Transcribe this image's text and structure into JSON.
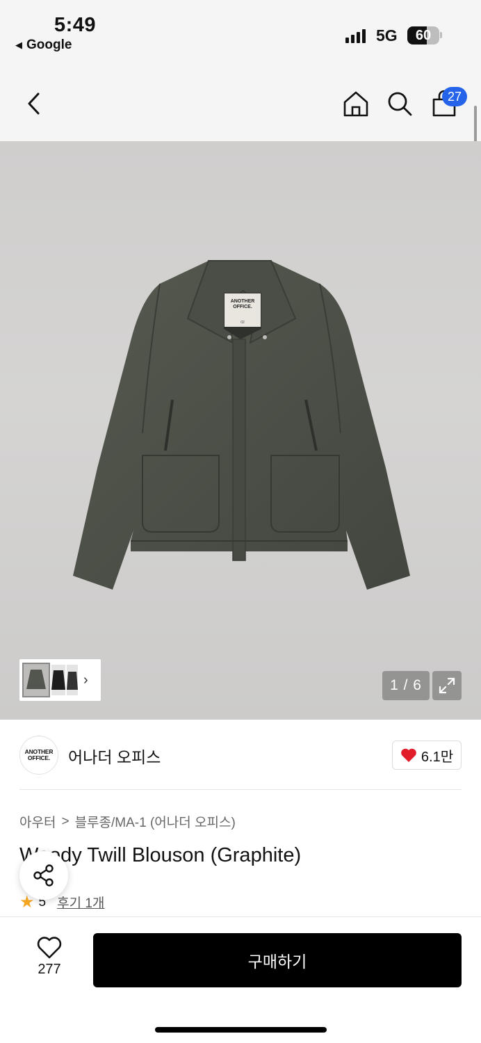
{
  "status_bar": {
    "time": "5:49",
    "back_app": "Google",
    "network": "5G",
    "battery": "60"
  },
  "nav": {
    "cart_count": "27",
    "icons": [
      "back-arrow-icon",
      "home-icon",
      "search-icon",
      "cart-icon"
    ]
  },
  "gallery": {
    "label_brand": "ANOTHER\nOFFICE.",
    "label_size": "02",
    "page_counter": "1 / 6"
  },
  "brand": {
    "logo_line1": "ANOTHER",
    "logo_line2": "OFFICE.",
    "name": "어나더 오피스",
    "likes": "6.1만"
  },
  "breadcrumb": {
    "category": "아우터",
    "separator": ">",
    "subcategory": "블루종/MA-1 (어나더 오피스)"
  },
  "product": {
    "title": "Woody Twill Blouson (Graphite)",
    "rating": "5",
    "review_label": "후기 1개"
  },
  "bottom_bar": {
    "wish_count": "277",
    "buy_label": "구매하기"
  },
  "colors": {
    "accent_badge": "#2563eb",
    "heart": "#e11d2a",
    "star": "#f5a623",
    "buy_button": "#000000"
  }
}
